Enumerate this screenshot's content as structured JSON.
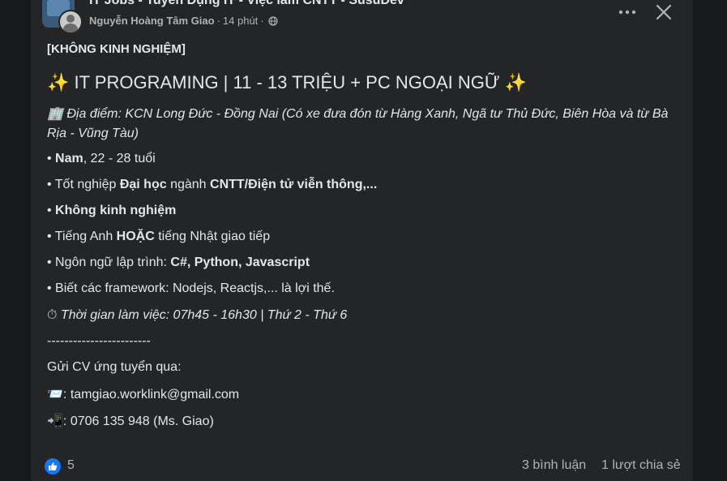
{
  "header": {
    "group_name": "IT Jobs - Tuyển Dụng IT - Việc làm CNTT - SusuDev",
    "author": "Nguyễn Hoàng Tâm Giao",
    "separator": "·",
    "time_ago": "14 phút",
    "privacy_icon": "globe-icon",
    "more_icon": "more-icon",
    "close_icon": "close-icon"
  },
  "post": {
    "tag": "[KHÔNG KINH NGHIỆM]",
    "title_emoji_left": "✨",
    "title": " IT PROGRAMING | 11 - 13 TRIỆU + PC NGOẠI NGỮ ",
    "title_emoji_right": "✨",
    "location_emoji": "🏢",
    "location_text": " Địa điểm: KCN Long Đức - Đồng Nai (Có xe đưa đón từ Hàng Xanh, Ngã tư Thủ Đức, Biên Hòa và từ Bà Rịa - Vũng Tàu)",
    "req1": {
      "bullet": "• ",
      "bold": "Nam",
      "rest": ", 22 - 28 tuổi"
    },
    "req2": {
      "bullet": "• ",
      "pre": "Tốt nghiệp ",
      "bold1": "Đại học",
      "mid": " ngành ",
      "bold2": "CNTT/Điện tử viễn thông,..."
    },
    "req3": {
      "bullet": "• ",
      "bold": "Không kinh nghiệm"
    },
    "req4": {
      "bullet": "• ",
      "pre": "Tiếng Anh ",
      "bold": "HOẶC",
      "rest": " tiếng Nhật giao tiếp"
    },
    "req5": {
      "bullet": "• ",
      "pre": "Ngôn ngữ lập trình: ",
      "bold": "C#, Python, Javascript"
    },
    "req6": {
      "bullet": "• ",
      "text": "Biết các framework: Nodejs, Reactjs,... là lợi thế."
    },
    "worktime_emoji": "⏱",
    "worktime_text": " Thời gian làm việc: 07h45 - 16h30 | Thứ 2 - Thứ 6",
    "divider": "------------------------",
    "cv_label": "Gửi CV ứng tuyển qua:",
    "email_emoji": "📨",
    "email": ": tamgiao.worklink@gmail.com",
    "phone_emoji": "📲",
    "phone": ": 0706 135 948 (Ms. Giao)"
  },
  "footer": {
    "like_icon": "thumbs-up-icon",
    "like_count": "5",
    "comments": "3 bình luận",
    "shares": "1 lượt chia sẻ"
  },
  "colors": {
    "background": "#18191a",
    "card": "#242526",
    "text_primary": "#e4e6eb",
    "text_secondary": "#b0b3b8",
    "like_blue": "#1877f2"
  }
}
